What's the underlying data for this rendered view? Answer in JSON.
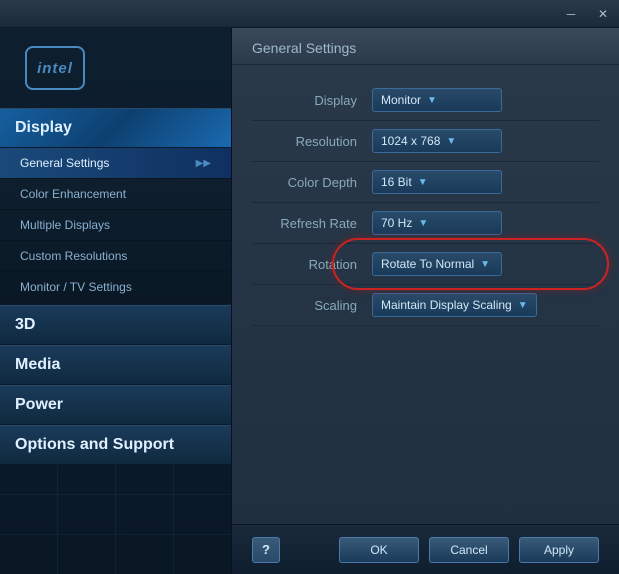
{
  "titlebar": {
    "minimize_label": "─",
    "close_label": "✕"
  },
  "sidebar": {
    "logo_text": "intel",
    "sections": [
      {
        "id": "display",
        "label": "Display",
        "active": true,
        "subitems": [
          {
            "id": "general-settings",
            "label": "General Settings",
            "active": true,
            "has_arrow": true
          },
          {
            "id": "color-enhancement",
            "label": "Color Enhancement",
            "active": false,
            "has_arrow": false
          },
          {
            "id": "multiple-displays",
            "label": "Multiple Displays",
            "active": false,
            "has_arrow": false
          },
          {
            "id": "custom-resolutions",
            "label": "Custom Resolutions",
            "active": false,
            "has_arrow": false
          },
          {
            "id": "monitor-tv-settings",
            "label": "Monitor / TV Settings",
            "active": false,
            "has_arrow": false
          }
        ]
      },
      {
        "id": "3d",
        "label": "3D",
        "active": false
      },
      {
        "id": "media",
        "label": "Media",
        "active": false
      },
      {
        "id": "power",
        "label": "Power",
        "active": false
      },
      {
        "id": "options-support",
        "label": "Options and Support",
        "active": false
      }
    ]
  },
  "content": {
    "header": "General Settings",
    "settings": [
      {
        "id": "display",
        "label": "Display",
        "value": "Monitor",
        "dropdown": true
      },
      {
        "id": "resolution",
        "label": "Resolution",
        "value": "1024 x 768",
        "dropdown": true
      },
      {
        "id": "color-depth",
        "label": "Color Depth",
        "value": "16 Bit",
        "dropdown": true
      },
      {
        "id": "refresh-rate",
        "label": "Refresh Rate",
        "value": "70 Hz",
        "dropdown": true
      },
      {
        "id": "rotation",
        "label": "Rotation",
        "value": "Rotate To Normal",
        "dropdown": true,
        "highlighted": true
      },
      {
        "id": "scaling",
        "label": "Scaling",
        "value": "Maintain Display Scaling",
        "dropdown": true
      }
    ]
  },
  "buttons": {
    "help": "?",
    "ok": "OK",
    "cancel": "Cancel",
    "apply": "Apply"
  }
}
